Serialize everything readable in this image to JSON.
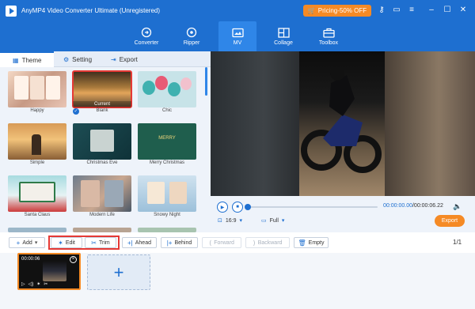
{
  "app": {
    "title": "AnyMP4 Video Converter Ultimate (Unregistered)",
    "pricing_label": "Pricing-50% OFF"
  },
  "nav": {
    "items": [
      {
        "label": "Converter",
        "icon": "converter-icon"
      },
      {
        "label": "Ripper",
        "icon": "ripper-icon"
      },
      {
        "label": "MV",
        "icon": "mv-icon",
        "active": true
      },
      {
        "label": "Collage",
        "icon": "collage-icon"
      },
      {
        "label": "Toolbox",
        "icon": "toolbox-icon"
      }
    ]
  },
  "left_tabs": [
    {
      "label": "Theme",
      "icon": "theme-icon",
      "active": true
    },
    {
      "label": "Setting",
      "icon": "gear-icon"
    },
    {
      "label": "Export",
      "icon": "export-icon"
    }
  ],
  "themes": [
    {
      "label": "Happy"
    },
    {
      "label": "Blank",
      "current_tag": "Current",
      "selected": true
    },
    {
      "label": "Chic"
    },
    {
      "label": "Simple"
    },
    {
      "label": "Christmas Eve"
    },
    {
      "label": "Merry Christmas"
    },
    {
      "label": "Santa Claus"
    },
    {
      "label": "Modern Life"
    },
    {
      "label": "Snowy Night"
    }
  ],
  "player": {
    "current_time": "00:00:00.00",
    "total_time": "/00:00:06.22",
    "progress": 0.0,
    "aspect_ratio": "16:9",
    "zoom_mode": "Full",
    "export_label": "Export"
  },
  "toolbar": {
    "add": "Add",
    "edit": "Edit",
    "trim": "Trim",
    "ahead": "Ahead",
    "behind": "Behind",
    "forward": "Forward",
    "backward": "Backward",
    "empty": "Empty",
    "page_count": "1/1"
  },
  "timeline": {
    "clip_time": "00:00:06"
  },
  "colors": {
    "brand": "#1e6fd0",
    "accent": "#f58a25",
    "highlight": "#e53935"
  }
}
